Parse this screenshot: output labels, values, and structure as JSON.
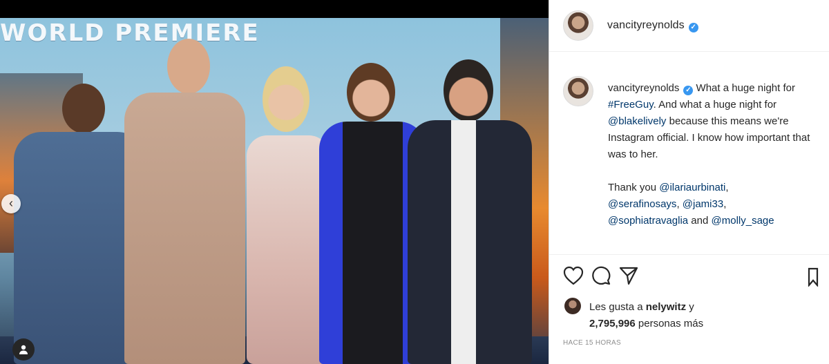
{
  "post": {
    "banner": "WORLD PREMIERE",
    "username": "vancityreynolds",
    "caption": {
      "username": "vancityreynolds",
      "parts": [
        {
          "text": " What a huge night for ",
          "mention": false
        },
        {
          "text": "#FreeGuy",
          "mention": true
        },
        {
          "text": ". And what a huge night for ",
          "mention": false
        },
        {
          "text": "@blakelively",
          "mention": true
        },
        {
          "text": " because this means we're Instagram official. I know how important that was to her.",
          "mention": false
        }
      ],
      "thanks_prefix": "Thank you ",
      "thanks_mentions": [
        "@ilariaurbinati",
        "@serafinosays",
        "@jami33",
        "@sophiatravaglia",
        "@molly_sage"
      ],
      "thanks_and": " and "
    },
    "likes": {
      "prefix": "Les gusta a ",
      "user": "nelywitz",
      "conj": " y",
      "count": "2,795,996",
      "suffix": " personas más"
    },
    "time": "HACE 15 HORAS",
    "icons": {
      "like": "heart-icon",
      "comment": "comment-icon",
      "share": "share-icon",
      "save": "bookmark-icon",
      "prev": "chevron-left-icon",
      "tags": "user-tag-icon"
    },
    "colors": {
      "mention": "#00376b",
      "verified": "#3897f0"
    }
  }
}
